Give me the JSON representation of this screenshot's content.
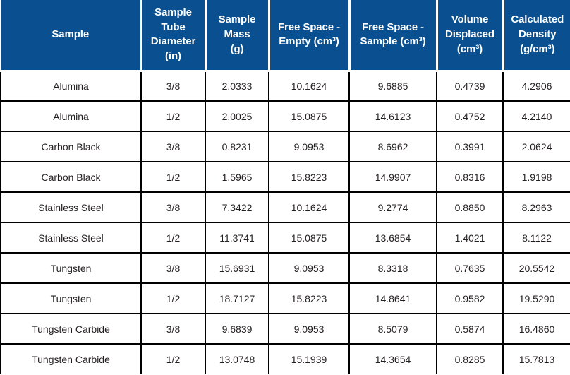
{
  "table": {
    "columns": [
      {
        "label": "Sample",
        "unit": ""
      },
      {
        "label": "Sample Tube Diameter (in)",
        "unit": ""
      },
      {
        "label": "Sample Mass (g)",
        "unit": ""
      },
      {
        "label": "Free Space - Empty (cm³)",
        "unit": "cm3"
      },
      {
        "label": "Free Space - Sample (cm³)",
        "unit": "cm3"
      },
      {
        "label": "Volume Displaced (cm³)",
        "unit": "cm3"
      },
      {
        "label": "Calculated Density (g/cm³)",
        "unit": "g/cm3"
      }
    ],
    "header_lines": {
      "c0": [
        "Sample"
      ],
      "c1": [
        "Sample",
        "Tube",
        "Diameter",
        "(in)"
      ],
      "c2": [
        "Sample",
        "Mass",
        "(g)"
      ],
      "c3": [
        "Free Space -",
        "Empty (cm³)"
      ],
      "c4": [
        "Free Space -",
        "Sample (cm³)"
      ],
      "c5": [
        "Volume",
        "Displaced",
        "(cm³)"
      ],
      "c6": [
        "Calculated",
        "Density",
        "(g/cm³)"
      ]
    },
    "rows": [
      {
        "sample": "Alumina",
        "tube_diameter": "3/8",
        "sample_mass": "2.0333",
        "free_space_empty": "10.1624",
        "free_space_sample": "9.6885",
        "volume_displaced": "0.4739",
        "calculated_density": "4.2906"
      },
      {
        "sample": "Alumina",
        "tube_diameter": "1/2",
        "sample_mass": "2.0025",
        "free_space_empty": "15.0875",
        "free_space_sample": "14.6123",
        "volume_displaced": "0.4752",
        "calculated_density": "4.2140"
      },
      {
        "sample": "Carbon Black",
        "tube_diameter": "3/8",
        "sample_mass": "0.8231",
        "free_space_empty": "9.0953",
        "free_space_sample": "8.6962",
        "volume_displaced": "0.3991",
        "calculated_density": "2.0624"
      },
      {
        "sample": "Carbon Black",
        "tube_diameter": "1/2",
        "sample_mass": "1.5965",
        "free_space_empty": "15.8223",
        "free_space_sample": "14.9907",
        "volume_displaced": "0.8316",
        "calculated_density": "1.9198"
      },
      {
        "sample": "Stainless Steel",
        "tube_diameter": "3/8",
        "sample_mass": "7.3422",
        "free_space_empty": "10.1624",
        "free_space_sample": "9.2774",
        "volume_displaced": "0.8850",
        "calculated_density": "8.2963"
      },
      {
        "sample": "Stainless Steel",
        "tube_diameter": "1/2",
        "sample_mass": "11.3741",
        "free_space_empty": "15.0875",
        "free_space_sample": "13.6854",
        "volume_displaced": "1.4021",
        "calculated_density": "8.1122"
      },
      {
        "sample": "Tungsten",
        "tube_diameter": "3/8",
        "sample_mass": "15.6931",
        "free_space_empty": "9.0953",
        "free_space_sample": "8.3318",
        "volume_displaced": "0.7635",
        "calculated_density": "20.5542"
      },
      {
        "sample": "Tungsten",
        "tube_diameter": "1/2",
        "sample_mass": "18.7127",
        "free_space_empty": "15.8223",
        "free_space_sample": "14.8641",
        "volume_displaced": "0.9582",
        "calculated_density": "19.5290"
      },
      {
        "sample": "Tungsten Carbide",
        "tube_diameter": "3/8",
        "sample_mass": "9.6839",
        "free_space_empty": "9.0953",
        "free_space_sample": "8.5079",
        "volume_displaced": "0.5874",
        "calculated_density": "16.4860"
      },
      {
        "sample": "Tungsten Carbide",
        "tube_diameter": "1/2",
        "sample_mass": "13.0748",
        "free_space_empty": "15.1939",
        "free_space_sample": "14.3654",
        "volume_displaced": "0.8285",
        "calculated_density": "15.7813"
      }
    ]
  },
  "colors": {
    "header_background": "#0a4f8f",
    "header_text": "#ffffff",
    "cell_text": "#231f20",
    "grid_line": "#000000",
    "cell_background": "#ffffff"
  }
}
